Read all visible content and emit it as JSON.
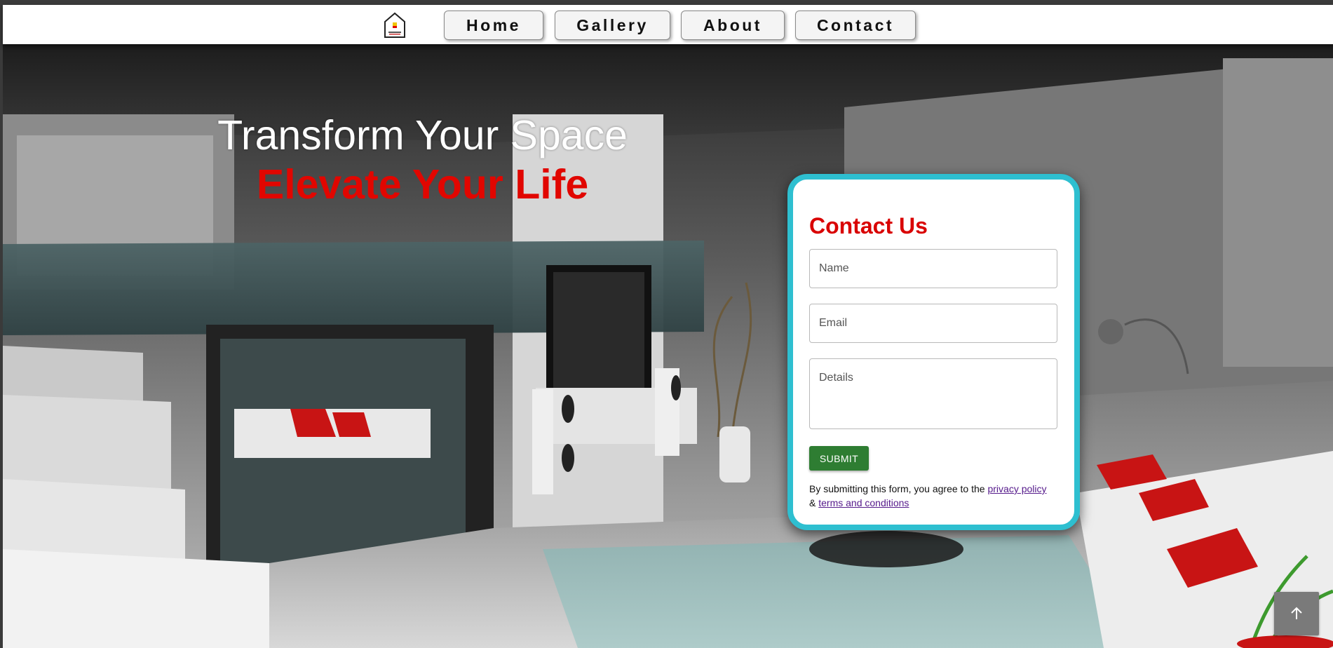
{
  "nav": {
    "logo_icon": "house-logo-icon",
    "items": [
      {
        "label": "Home"
      },
      {
        "label": "Gallery"
      },
      {
        "label": "About"
      },
      {
        "label": "Contact"
      }
    ]
  },
  "hero": {
    "line1": "Transform Your Space",
    "line2": "Elevate Your Life"
  },
  "contact": {
    "title": "Contact Us",
    "name_placeholder": "Name",
    "email_placeholder": "Email",
    "details_placeholder": "Details",
    "submit_label": "SUBMIT",
    "disclaimer_prefix": "By submitting this form, you agree to the",
    "privacy_link": "privacy policy",
    "amp": "&",
    "terms_link": "terms and conditions"
  },
  "scroll_top_icon": "arrow-up-icon",
  "colors": {
    "accent_red": "#e10600",
    "card_border": "#2ebfd0",
    "submit_green": "#2e7d32"
  }
}
